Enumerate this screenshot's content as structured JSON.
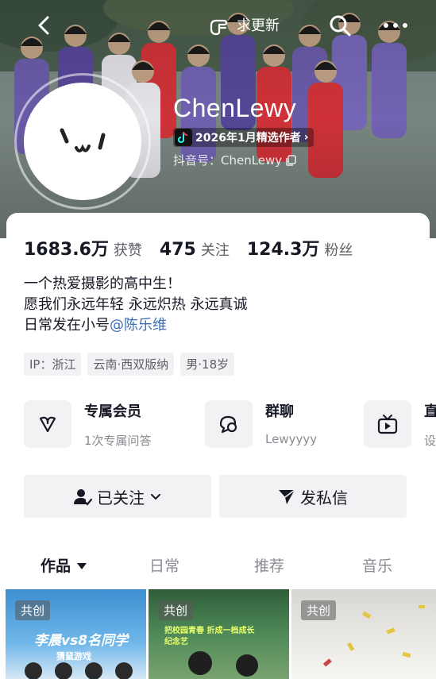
{
  "header": {
    "update_label": "求更新",
    "back_icon": "chevron-left-icon",
    "search_icon": "search-icon",
    "more_icon": "more-dots-icon"
  },
  "profile": {
    "nickname": "ChenLewy",
    "author_badge": "2026年1月精选作者",
    "douyin_id": "抖音号：ChenLewy"
  },
  "stats": [
    {
      "value": "1683.6万",
      "label": "获赞"
    },
    {
      "value": "475",
      "label": "关注"
    },
    {
      "value": "124.3万",
      "label": "粉丝"
    }
  ],
  "bio": {
    "line1": "一个热爱摄影的高中生！",
    "line2": "愿我们永远年轻 永远炽热 永远真诚",
    "line3_prefix": "日常发在小号",
    "line3_mention": "@陈乐维"
  },
  "tags": [
    "IP：浙江",
    "云南·西双版纳",
    "男·18岁"
  ],
  "services": [
    {
      "title": "专属会员",
      "subtitle": "1次专属问答",
      "icon": "heart-v-icon"
    },
    {
      "title": "群聊",
      "subtitle": "Lewyyyy",
      "icon": "chat-bubble-icon"
    },
    {
      "title": "直",
      "subtitle": "设",
      "icon": "tv-play-icon"
    }
  ],
  "actions": {
    "follow_label": "已关注",
    "message_label": "发私信"
  },
  "tabs": [
    {
      "label": "作品",
      "active": true
    },
    {
      "label": "日常",
      "active": false
    },
    {
      "label": "推荐",
      "active": false
    },
    {
      "label": "音乐",
      "active": false
    }
  ],
  "videos": [
    {
      "badge": "共创",
      "caption": "李晨vs8名同学",
      "subcaption": "猜鼠游戏"
    },
    {
      "badge": "共创",
      "caption": "把校园青春 折成一档成长纪念艺"
    },
    {
      "badge": "共创"
    }
  ],
  "colors": {
    "mention": "#3b6fb6",
    "chip_bg": "#f2f2f4",
    "text_primary": "#161823",
    "text_secondary": "#8a8a92"
  }
}
